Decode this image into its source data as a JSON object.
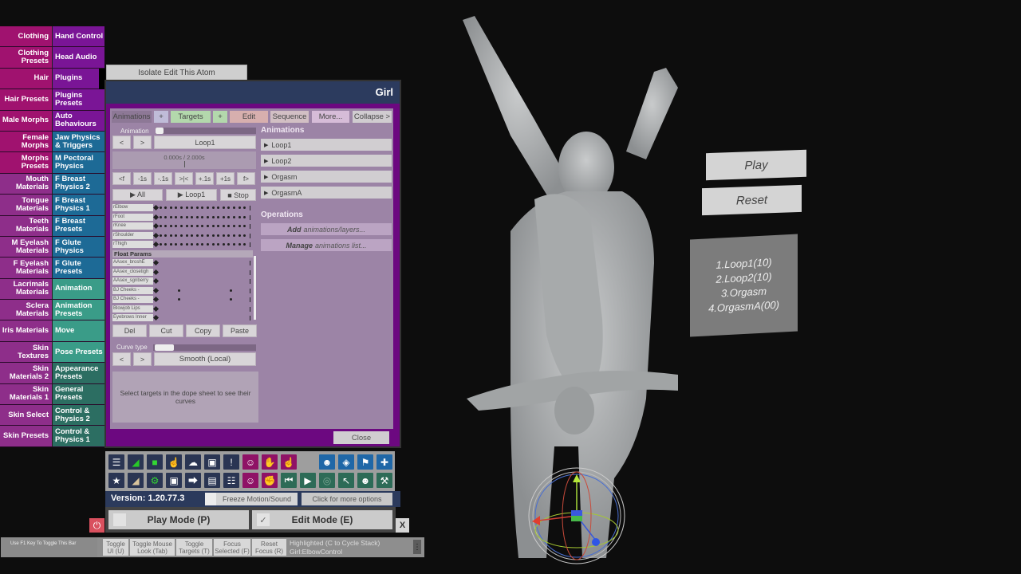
{
  "category_menu": [
    {
      "left": "Clothing",
      "right": "Hand Control",
      "lc": "c-mag",
      "rc": "c-pur"
    },
    {
      "left": "Clothing Presets",
      "right": "Head Audio",
      "lc": "c-mag",
      "rc": "c-pur"
    },
    {
      "left": "Hair",
      "right": "Plugins",
      "lc": "c-mag",
      "rc": "c-pur"
    },
    {
      "left": "Hair Presets",
      "right": "Plugins Presets",
      "lc": "c-mag",
      "rc": "c-pur"
    },
    {
      "left": "Male Morphs",
      "right": "Auto Behaviours",
      "lc": "c-mag",
      "rc": "c-pur"
    },
    {
      "left": "Female Morphs",
      "right": "Jaw Physics & Triggers",
      "lc": "c-mag",
      "rc": "c-blue"
    },
    {
      "left": "Morphs Presets",
      "right": "M Pectoral Physics",
      "lc": "c-mag",
      "rc": "c-blue"
    },
    {
      "left": "Mouth Materials",
      "right": "F Breast Physics 2",
      "lc": "c-mag2",
      "rc": "c-blue"
    },
    {
      "left": "Tongue Materials",
      "right": "F Breast Physics 1",
      "lc": "c-mag2",
      "rc": "c-blue"
    },
    {
      "left": "Teeth Materials",
      "right": "F Breast Presets",
      "lc": "c-mag2",
      "rc": "c-blue"
    },
    {
      "left": "M Eyelash Materials",
      "right": "F Glute Physics",
      "lc": "c-mag2",
      "rc": "c-blue"
    },
    {
      "left": "F Eyelash Materials",
      "right": "F Glute Presets",
      "lc": "c-mag2",
      "rc": "c-blue"
    },
    {
      "left": "Lacrimals Materials",
      "right": "Animation",
      "lc": "c-mag2",
      "rc": "c-teal"
    },
    {
      "left": "Sclera Materials",
      "right": "Animation Presets",
      "lc": "c-mag2",
      "rc": "c-teal"
    },
    {
      "left": "Iris Materials",
      "right": "Move",
      "lc": "c-mag2",
      "rc": "c-teal"
    },
    {
      "left": "Skin Textures",
      "right": "Pose Presets",
      "lc": "c-mag2",
      "rc": "c-teal"
    },
    {
      "left": "Skin Materials 2",
      "right": "Appearance Presets",
      "lc": "c-mag2",
      "rc": "c-dteal"
    },
    {
      "left": "Skin Materials 1",
      "right": "General Presets",
      "lc": "c-mag2",
      "rc": "c-dteal"
    },
    {
      "left": "Skin Select",
      "right": "Control & Physics 2",
      "lc": "c-mag2",
      "rc": "c-dteal"
    },
    {
      "left": "Skin Presets",
      "right": "Control & Physics 1",
      "lc": "c-mag2",
      "rc": "c-dteal"
    }
  ],
  "isolate_button": "Isolate Edit This Atom",
  "window": {
    "title": "Girl",
    "tabs": {
      "animations": "Animations",
      "add_animation": "+",
      "targets": "Targets",
      "add_target": "+",
      "edit": "Edit",
      "sequence": "Sequence",
      "more": "More...",
      "collapse": "Collapse >"
    },
    "animation_label": "Animation",
    "prev": "<",
    "next": ">",
    "current_animation": "Loop1",
    "time_display": "0.000s / 2.000s",
    "scrub_position": 0.0,
    "step_buttons": [
      "<f",
      "-1s",
      "-.1s",
      ">|<",
      "+.1s",
      "+1s",
      "f>"
    ],
    "play_all": "▶ All",
    "play_current": "▶ Loop1",
    "stop": "■ Stop",
    "dope_sheet": {
      "targets": [
        "rElbow",
        "rFoot",
        "rKnee",
        "rShoulder",
        "rThigh"
      ],
      "float_params_title": "Float Params",
      "float_params": [
        "AAsex_broshÉ",
        "AAsex_closetigh",
        "AAsex_sgnberry",
        "BJ Cheeks -",
        "BJ Cheeks -",
        "Blowjob Lips",
        "Eyebrows Inner"
      ]
    },
    "edit_buttons": {
      "del": "Del",
      "cut": "Cut",
      "copy": "Copy",
      "paste": "Paste"
    },
    "curve_type_label": "Curve type",
    "curve_type_value": "Smooth (Local)",
    "curve_info": "Select targets in the dope sheet to see their curves",
    "animations_title": "Animations",
    "animations": [
      "Loop1",
      "Loop2",
      "Orgasm",
      "OrgasmA"
    ],
    "operations_title": "Operations",
    "operations": [
      {
        "bold": "Add",
        "rest": "animations/layers..."
      },
      {
        "bold": "Manage",
        "rest": "animations list..."
      }
    ],
    "close": "Close"
  },
  "toolbar": {
    "row1": [
      {
        "icon": "menu-icon",
        "glyph": "☰",
        "color": "tb-navy"
      },
      {
        "icon": "open-scene-icon",
        "glyph": "◢",
        "color": "tb-navy",
        "fg": "#28c828"
      },
      {
        "icon": "folder-icon",
        "glyph": "■",
        "color": "tb-navy",
        "fg": "#33d633"
      },
      {
        "icon": "hand-point-red-icon",
        "glyph": "☝",
        "color": "tb-navy",
        "fg": "#e02b2b"
      },
      {
        "icon": "cloud-download-icon",
        "glyph": "☁",
        "color": "tb-navy"
      },
      {
        "icon": "package-icon",
        "glyph": "▣",
        "color": "tb-navy"
      },
      {
        "icon": "alert-icon",
        "glyph": "!",
        "color": "tb-navy"
      },
      {
        "icon": "add-person-icon",
        "glyph": "☺",
        "color": "tb-mag"
      },
      {
        "icon": "hand-icon",
        "glyph": "✋",
        "color": "tb-mag"
      },
      {
        "icon": "pointer-hand-icon",
        "glyph": "☝",
        "color": "tb-mag"
      },
      {
        "icon": "person-icon",
        "glyph": "☻",
        "color": "tb-blue"
      },
      {
        "icon": "unity-icon",
        "glyph": "◈",
        "color": "tb-blue"
      },
      {
        "icon": "flag-icon",
        "glyph": "⚑",
        "color": "tb-blue"
      },
      {
        "icon": "plus-icon",
        "glyph": "✚",
        "color": "tb-blue"
      }
    ],
    "row2": [
      {
        "icon": "star-icon",
        "glyph": "★",
        "color": "tb-navy"
      },
      {
        "icon": "open-scene-beige-icon",
        "glyph": "◢",
        "color": "tb-navy",
        "fg": "#d9c49c"
      },
      {
        "icon": "folder-settings-icon",
        "glyph": "⚙",
        "color": "tb-navy",
        "fg": "#33d633"
      },
      {
        "icon": "camera-icon",
        "glyph": "▣",
        "color": "tb-navy"
      },
      {
        "icon": "share-nodes-icon",
        "glyph": "⮕",
        "color": "tb-navy"
      },
      {
        "icon": "open-box-icon",
        "glyph": "▤",
        "color": "tb-navy"
      },
      {
        "icon": "clipboard-icon",
        "glyph": "☷",
        "color": "tb-navy"
      },
      {
        "icon": "remove-person-icon",
        "glyph": "☺",
        "color": "tb-mag"
      },
      {
        "icon": "grab-hand-icon",
        "glyph": "✊",
        "color": "tb-mag"
      },
      {
        "icon": "skip-back-icon",
        "glyph": "⏮",
        "color": "tb-green"
      },
      {
        "icon": "play-icon",
        "glyph": "▶",
        "color": "tb-green"
      },
      {
        "icon": "target-icon",
        "glyph": "◎",
        "color": "tb-green",
        "fg": "#7ea896"
      },
      {
        "icon": "cursor-icon",
        "glyph": "↖",
        "color": "tb-green"
      },
      {
        "icon": "people-icon",
        "glyph": "☻",
        "color": "tb-green"
      },
      {
        "icon": "tools-icon",
        "glyph": "⚒",
        "color": "tb-green"
      }
    ]
  },
  "version_bar": {
    "version": "Version: 1.20.77.3",
    "freeze": "Freeze Motion/Sound",
    "more_options": "Click for more options"
  },
  "mode_bar": {
    "play_mode": "Play Mode (P)",
    "play_checked": false,
    "edit_mode": "Edit Mode (E)",
    "edit_checked": true,
    "check_glyph": "✓",
    "close_x": "X",
    "power_glyph": "⏻"
  },
  "bottom_bar": {
    "f1_hint": "Use F1 Key To Toggle This Bar",
    "buttons": [
      "Toggle UI (U)",
      "Toggle Mouse Look (Tab)",
      "Toggle Targets (T)",
      "Focus Selected (F)",
      "Reset Focus (R)"
    ],
    "highlighted_line1": "Highlighted (C to Cycle Stack)",
    "highlighted_line2": "Girl:ElbowControl",
    "menu_glyph": "⋮"
  },
  "scene": {
    "play_button": "Play",
    "reset_button": "Reset",
    "loop_list": [
      "1.Loop1(10)",
      "2.Loop2(10)",
      "3.Orgasm",
      "4.OrgasmA(00)"
    ]
  }
}
